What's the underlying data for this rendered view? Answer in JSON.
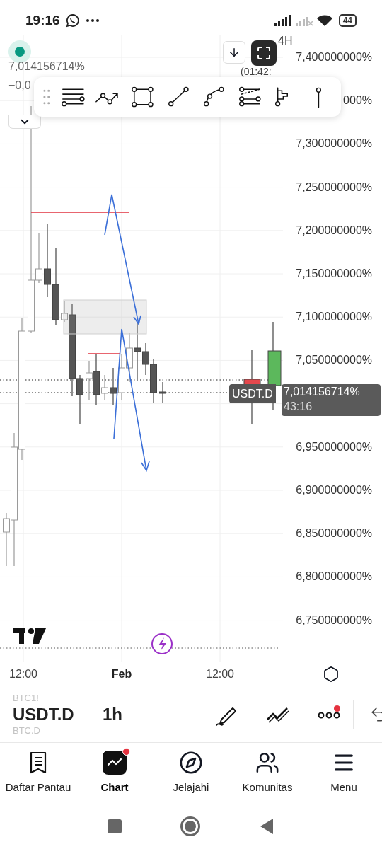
{
  "status_bar": {
    "time": "19:16",
    "battery": "44"
  },
  "chart": {
    "last_price": "7,014156714%",
    "change": "−0,0",
    "interval": "4H",
    "countdown": "(01:42:",
    "price_axis": [
      "7,400000000%",
      "000%",
      "7,300000000%",
      "7,250000000%",
      "7,200000000%",
      "7,150000000%",
      "7,100000000%",
      "7,050000000%",
      "6,950000000%",
      "6,900000000%",
      "6,850000000%",
      "6,800000000%",
      "6,750000000%"
    ],
    "time_axis": [
      {
        "label": "12:00",
        "kind": "time"
      },
      {
        "label": "Feb",
        "kind": "month"
      },
      {
        "label": "12:00",
        "kind": "time"
      }
    ],
    "symbol_tag": "USDT.D",
    "price_tag": "7,014156714%",
    "timer": "43:16"
  },
  "symbols": [
    {
      "label": "BTC1!",
      "selected": false
    },
    {
      "label": "USDT.D",
      "selected": true
    },
    {
      "label": "BTC.D",
      "selected": false
    }
  ],
  "timeframe": "1h",
  "more_notification": true,
  "nav": [
    {
      "label": "Daftar Pantau",
      "kind": "watchlist",
      "selected": false,
      "notification": false
    },
    {
      "label": "Chart",
      "kind": "chart",
      "selected": true,
      "notification": true
    },
    {
      "label": "Jelajahi",
      "kind": "explore",
      "selected": false,
      "notification": false
    },
    {
      "label": "Komunitas",
      "kind": "community",
      "selected": false,
      "notification": false
    },
    {
      "label": "Menu",
      "kind": "menu",
      "selected": false,
      "notification": false
    }
  ]
}
